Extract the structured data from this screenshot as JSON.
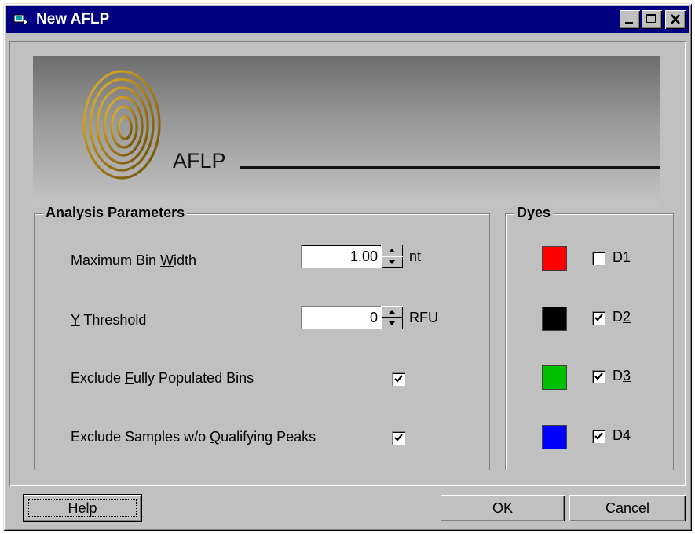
{
  "window": {
    "title": "New AFLP"
  },
  "banner": {
    "label": "AFLP"
  },
  "analysis": {
    "group_title": "Analysis Parameters",
    "max_bin_width": {
      "label_pre": "Maximum Bin ",
      "label_key": "W",
      "label_post": "idth",
      "value": "1.00",
      "unit": "nt"
    },
    "y_threshold": {
      "label_pre": "",
      "label_key": "Y",
      "label_post": " Threshold",
      "value": "0",
      "unit": "RFU"
    },
    "exclude_full": {
      "label_pre": "Exclude ",
      "label_key": "F",
      "label_post": "ully Populated Bins",
      "checked": true
    },
    "exclude_samples": {
      "label_pre": "Exclude Samples w/o ",
      "label_key": "Q",
      "label_post": "ualifying Peaks",
      "checked": true
    }
  },
  "dyes": {
    "group_title": "Dyes",
    "items": [
      {
        "name_pre": "D",
        "name_key": "1",
        "color": "#ff0000",
        "checked": false
      },
      {
        "name_pre": "D",
        "name_key": "2",
        "color": "#000000",
        "checked": true
      },
      {
        "name_pre": "D",
        "name_key": "3",
        "color": "#00c000",
        "checked": true
      },
      {
        "name_pre": "D",
        "name_key": "4",
        "color": "#0000ff",
        "checked": true
      }
    ]
  },
  "buttons": {
    "help": "Help",
    "ok": "OK",
    "cancel": "Cancel"
  },
  "colors": {
    "titlebar": "#000080",
    "face": "#c0c0c0"
  }
}
